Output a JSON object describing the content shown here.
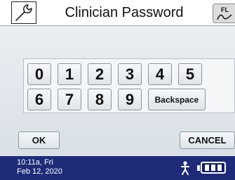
{
  "header": {
    "title": "Clinician Password",
    "settings_icon": "wrench-icon",
    "flow_label": "FL"
  },
  "keypad": {
    "keys": [
      "0",
      "1",
      "2",
      "3",
      "4",
      "5",
      "6",
      "7",
      "8",
      "9"
    ],
    "backspace_label": "Backspace"
  },
  "actions": {
    "ok_label": "OK",
    "cancel_label": "CANCEL"
  },
  "status": {
    "time": "10:11a, Fri",
    "date": "Feb 12, 2020",
    "person_icon": "person-icon",
    "battery_icon": "battery-icon",
    "battery_level": 1.0
  },
  "colors": {
    "status_bar": "#1e2b78",
    "panel": "#e2e8ed"
  }
}
